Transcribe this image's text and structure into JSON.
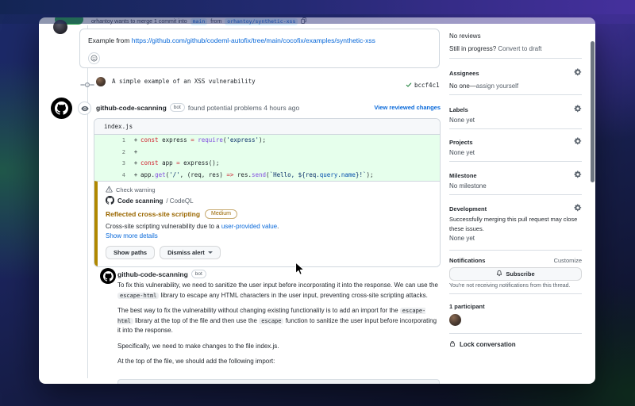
{
  "colors": {
    "accent_blue": "#0969da",
    "warning_title": "#9a6700",
    "warning_border": "#b08800",
    "added_line_bg": "#e6ffec",
    "open_badge_green": "#2da44e"
  },
  "top_bar": {
    "merge_text": "orhantoy wants to merge 1 commit into",
    "base_branch": "main",
    "from_label": "from",
    "head_branch": "orhantoy/synthetic-xss"
  },
  "description_comment": {
    "prefix": "Example from ",
    "link": "https://github.com/github/codeml-autofix/tree/main/cocofix/examples/synthetic-xss"
  },
  "commit": {
    "message": "A simple example of an XSS vulnerability",
    "sha": "bccf4c1"
  },
  "review": {
    "author": "github-code-scanning",
    "bot_badge": "bot",
    "summary": "found potential problems 4 hours ago",
    "link": "View reviewed changes",
    "file": {
      "name": "index.js",
      "lines": [
        {
          "no": "1",
          "sign": "+",
          "tokens": [
            {
              "t": "const",
              "c": "k"
            },
            {
              "t": " express ",
              "c": "p"
            },
            {
              "t": "=",
              "c": "k"
            },
            {
              "t": " ",
              "c": "p"
            },
            {
              "t": "require",
              "c": "f"
            },
            {
              "t": "(",
              "c": "p"
            },
            {
              "t": "'express'",
              "c": "s"
            },
            {
              "t": ");",
              "c": "p"
            }
          ]
        },
        {
          "no": "2",
          "sign": "+",
          "tokens": []
        },
        {
          "no": "3",
          "sign": "+",
          "tokens": [
            {
              "t": "const",
              "c": "k"
            },
            {
              "t": " app ",
              "c": "p"
            },
            {
              "t": "=",
              "c": "k"
            },
            {
              "t": " express();",
              "c": "p"
            }
          ]
        },
        {
          "no": "4",
          "sign": "+",
          "tokens": [
            {
              "t": "app.",
              "c": "p"
            },
            {
              "t": "get",
              "c": "f"
            },
            {
              "t": "(",
              "c": "p"
            },
            {
              "t": "'/'",
              "c": "s"
            },
            {
              "t": ", (req, res) ",
              "c": "p"
            },
            {
              "t": "=>",
              "c": "k"
            },
            {
              "t": " res.",
              "c": "p"
            },
            {
              "t": "send",
              "c": "f"
            },
            {
              "t": "(",
              "c": "p"
            },
            {
              "t": "`Hello, ${req.",
              "c": "s"
            },
            {
              "t": "query",
              "c": "v"
            },
            {
              "t": ".",
              "c": "s"
            },
            {
              "t": "name",
              "c": "v"
            },
            {
              "t": "}!`",
              "c": "s"
            },
            {
              "t": ");",
              "c": "p"
            }
          ]
        }
      ]
    },
    "alert": {
      "check_label": "Check warning",
      "tool": "Code scanning",
      "tool_name": "/ CodeQL",
      "title": "Reflected cross-site scripting",
      "severity": "Medium",
      "desc_prefix": "Cross-site scripting vulnerability due to a ",
      "desc_link": "user-provided value",
      "desc_suffix": ".",
      "details_link": "Show more details",
      "show_paths": "Show paths",
      "dismiss": "Dismiss alert"
    },
    "comment": {
      "author": "github-code-scanning",
      "bot_badge": "bot",
      "paragraphs": [
        [
          {
            "t": "To fix this vulnerability, we need to sanitize the user input before incorporating it into the response. We can use the "
          },
          {
            "t": "escape-html",
            "code": true
          },
          {
            "t": " library to escape any HTML characters in the user input, preventing cross-site scripting attacks."
          }
        ],
        [
          {
            "t": "The best way to fix the vulnerability without changing existing functionality is to add an import for the "
          },
          {
            "t": "escape-html",
            "code": true
          },
          {
            "t": " library at the top of the file and then use the "
          },
          {
            "t": "escape",
            "code": true
          },
          {
            "t": " function to sanitize the user input before incorporating it into the response."
          }
        ],
        [
          {
            "t": "Specifically, we need to make changes to the file index.js."
          }
        ],
        [
          {
            "t": "At the top of the file, we should add the following import:"
          }
        ]
      ]
    }
  },
  "sidebar": {
    "reviews": {
      "status": "No reviews",
      "progress": "Still in progress?",
      "draft_link": "Convert to draft"
    },
    "assignees": {
      "title": "Assignees",
      "empty": "No one—",
      "self_link": "assign yourself"
    },
    "labels": {
      "title": "Labels",
      "empty": "None yet"
    },
    "projects": {
      "title": "Projects",
      "empty": "None yet"
    },
    "milestone": {
      "title": "Milestone",
      "empty": "No milestone"
    },
    "development": {
      "title": "Development",
      "desc": "Successfully merging this pull request may close these issues.",
      "empty": "None yet"
    },
    "notifications": {
      "title": "Notifications",
      "customize": "Customize",
      "subscribe": "Subscribe",
      "note": "You're not receiving notifications from this thread."
    },
    "participants": {
      "label": "1 participant"
    },
    "lock_label": "Lock conversation"
  }
}
